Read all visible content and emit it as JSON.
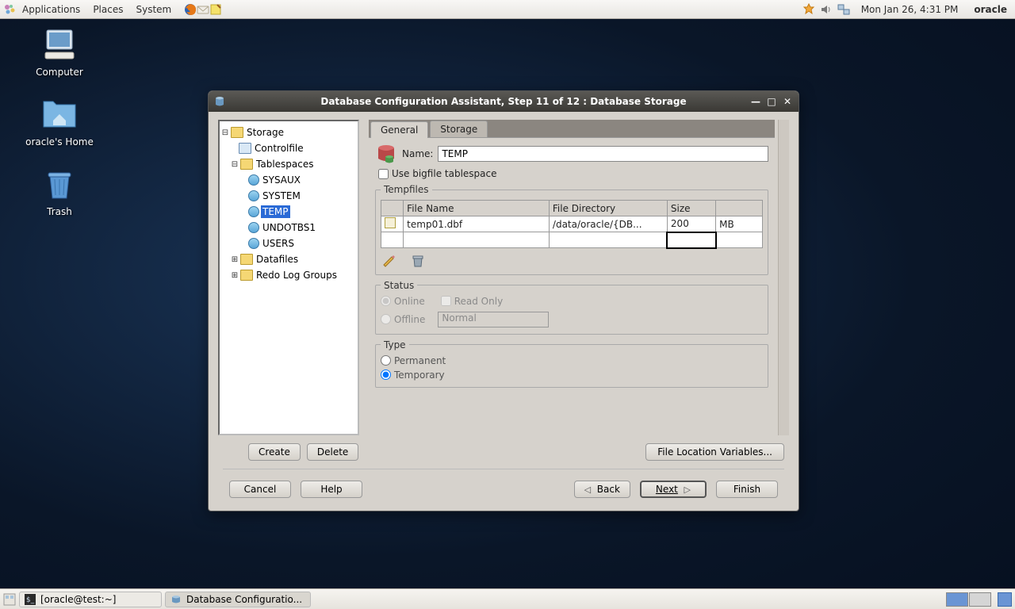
{
  "top_panel": {
    "menus": [
      "Applications",
      "Places",
      "System"
    ],
    "clock": "Mon Jan 26,  4:31 PM",
    "user": "oracle"
  },
  "desktop": {
    "icons": [
      {
        "label": "Computer"
      },
      {
        "label": "oracle's Home"
      },
      {
        "label": "Trash"
      }
    ]
  },
  "window": {
    "title": "Database Configuration Assistant, Step 11 of 12 : Database Storage",
    "tree": {
      "root": "Storage",
      "controlfile": "Controlfile",
      "tablespaces": "Tablespaces",
      "ts_items": [
        "SYSAUX",
        "SYSTEM",
        "TEMP",
        "UNDOTBS1",
        "USERS"
      ],
      "ts_selected": "TEMP",
      "datafiles": "Datafiles",
      "redolog": "Redo Log Groups"
    },
    "tabs": {
      "general": "General",
      "storage": "Storage"
    },
    "name_label": "Name:",
    "name_value": "TEMP",
    "bigfile_label": "Use bigfile tablespace",
    "tempfiles_legend": "Tempfiles",
    "table": {
      "h_filename": "File Name",
      "h_filedir": "File Directory",
      "h_size": "Size",
      "row": {
        "filename": "temp01.dbf",
        "filedir": "/data/oracle/{DB...",
        "size": "200",
        "unit": "MB"
      }
    },
    "status_legend": "Status",
    "status": {
      "online": "Online",
      "offline": "Offline",
      "readonly": "Read Only",
      "offline_mode": "Normal"
    },
    "type_legend": "Type",
    "type": {
      "permanent": "Permanent",
      "temporary": "Temporary"
    },
    "buttons": {
      "create": "Create",
      "delete": "Delete",
      "file_vars": "File Location Variables...",
      "cancel": "Cancel",
      "help": "Help",
      "back": "Back",
      "next": "Next",
      "finish": "Finish"
    }
  },
  "bottom_panel": {
    "task1": "[oracle@test:~]",
    "task2": "Database Configuratio..."
  }
}
